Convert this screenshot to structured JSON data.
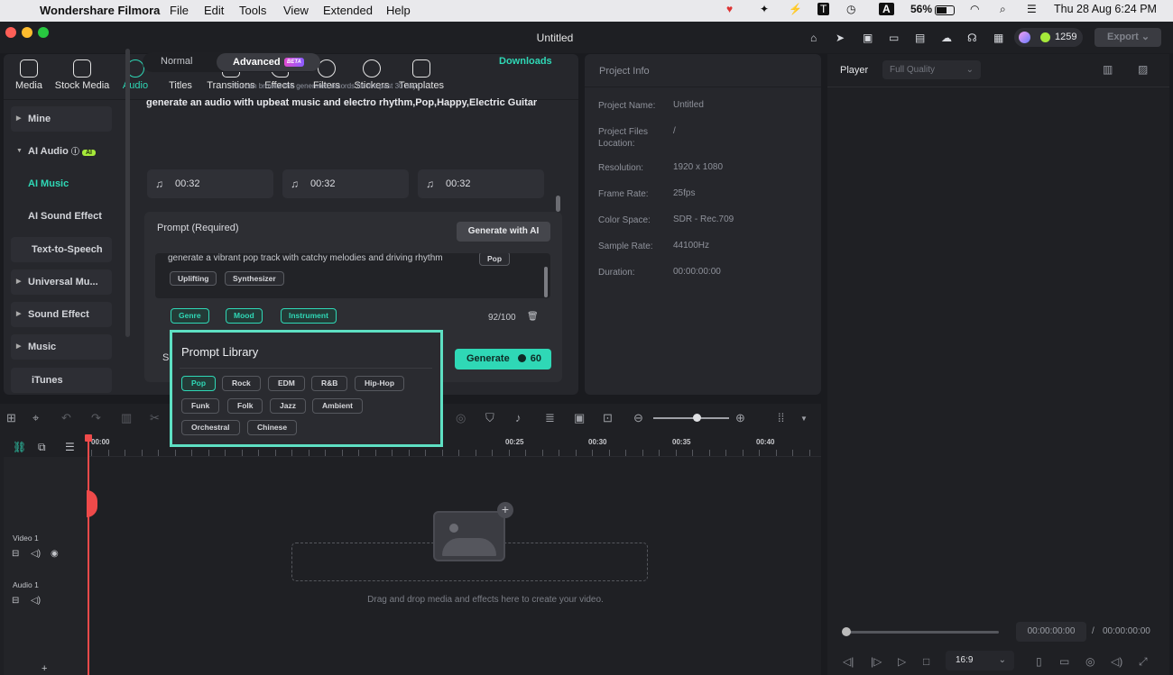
{
  "menubar": {
    "app_name": "Wondershare Filmora",
    "items": [
      "File",
      "Edit",
      "Tools",
      "View",
      "Extended",
      "Help"
    ],
    "battery": "56%",
    "datetime": "Thu 28 Aug  6:24 PM"
  },
  "window": {
    "title": "Untitled",
    "credits": "1259",
    "export_label": "Export"
  },
  "tabs": [
    {
      "label": "Media",
      "icon": "media-icon"
    },
    {
      "label": "Stock Media",
      "icon": "stock-media-icon"
    },
    {
      "label": "Audio",
      "icon": "audio-icon",
      "active": true
    },
    {
      "label": "Titles",
      "icon": "titles-icon"
    },
    {
      "label": "Transitions",
      "icon": "transitions-icon"
    },
    {
      "label": "Effects",
      "icon": "effects-icon"
    },
    {
      "label": "Filters",
      "icon": "filters-icon"
    },
    {
      "label": "Stickers",
      "icon": "stickers-icon"
    },
    {
      "label": "Templates",
      "icon": "templates-icon"
    }
  ],
  "sidebar": {
    "mine": "Mine",
    "ai_audio": "AI Audio",
    "ai_badge": "AI",
    "ai_music": "AI Music",
    "ai_sound_effect": "AI Sound Effect",
    "tts": "Text-to-Speech",
    "universal": "Universal Mu...",
    "sound_effect": "Sound Effect",
    "music": "Music",
    "itunes": "iTunes"
  },
  "ai_music": {
    "mode_normal": "Normal",
    "mode_advanced": "Advanced",
    "beta": "BETA",
    "downloads": "Downloads",
    "browse_note": "You can browse the generated records for the past 30 days.",
    "record_title": "generate an audio with upbeat music and electro rhythm,Pop,Happy,Electric Guitar",
    "tracks": [
      "00:32",
      "00:32",
      "00:32"
    ],
    "prompt_label": "Prompt (Required)",
    "generate_with_ai": "Generate with AI",
    "prompt_text": "generate a vibrant pop track with catchy melodies and driving rhythm",
    "prompt_tags": [
      "Pop",
      "Uplifting",
      "Synthesizer"
    ],
    "category_tags": [
      "Genre",
      "Mood",
      "Instrument"
    ],
    "char_count": "92/100",
    "generate_label": "Generate",
    "generate_cost": "60",
    "hidden_fragment": "S"
  },
  "prompt_library": {
    "title": "Prompt Library",
    "chips": [
      "Pop",
      "Rock",
      "EDM",
      "R&B",
      "Hip-Hop",
      "Funk",
      "Folk",
      "Jazz",
      "Ambient",
      "Orchestral",
      "Chinese"
    ],
    "selected": "Pop"
  },
  "project_info": {
    "header": "Project Info",
    "rows": [
      {
        "key": "Project Name:",
        "value": "Untitled"
      },
      {
        "key": "Project Files Location:",
        "value": "/"
      },
      {
        "key": "Resolution:",
        "value": "1920 x 1080"
      },
      {
        "key": "Frame Rate:",
        "value": "25fps"
      },
      {
        "key": "Color Space:",
        "value": "SDR - Rec.709"
      },
      {
        "key": "Sample Rate:",
        "value": "44100Hz"
      },
      {
        "key": "Duration:",
        "value": "00:00:00:00"
      }
    ]
  },
  "player": {
    "label": "Player",
    "quality": "Full Quality",
    "current_time": "00:00:00:00",
    "separator": "/",
    "total_time": "00:00:00:00",
    "aspect_ratio": "16:9"
  },
  "timeline": {
    "ruler_labels": [
      "00:00",
      "00:25",
      "00:30",
      "00:35",
      "00:40"
    ],
    "tracks": [
      "Video 1",
      "Audio 1"
    ],
    "drop_hint": "Drag and drop media and effects here to create your video."
  },
  "colors": {
    "accent": "#2fd8b6",
    "playhead": "#ef4a4a",
    "highlight_border": "#5ee0c3"
  }
}
